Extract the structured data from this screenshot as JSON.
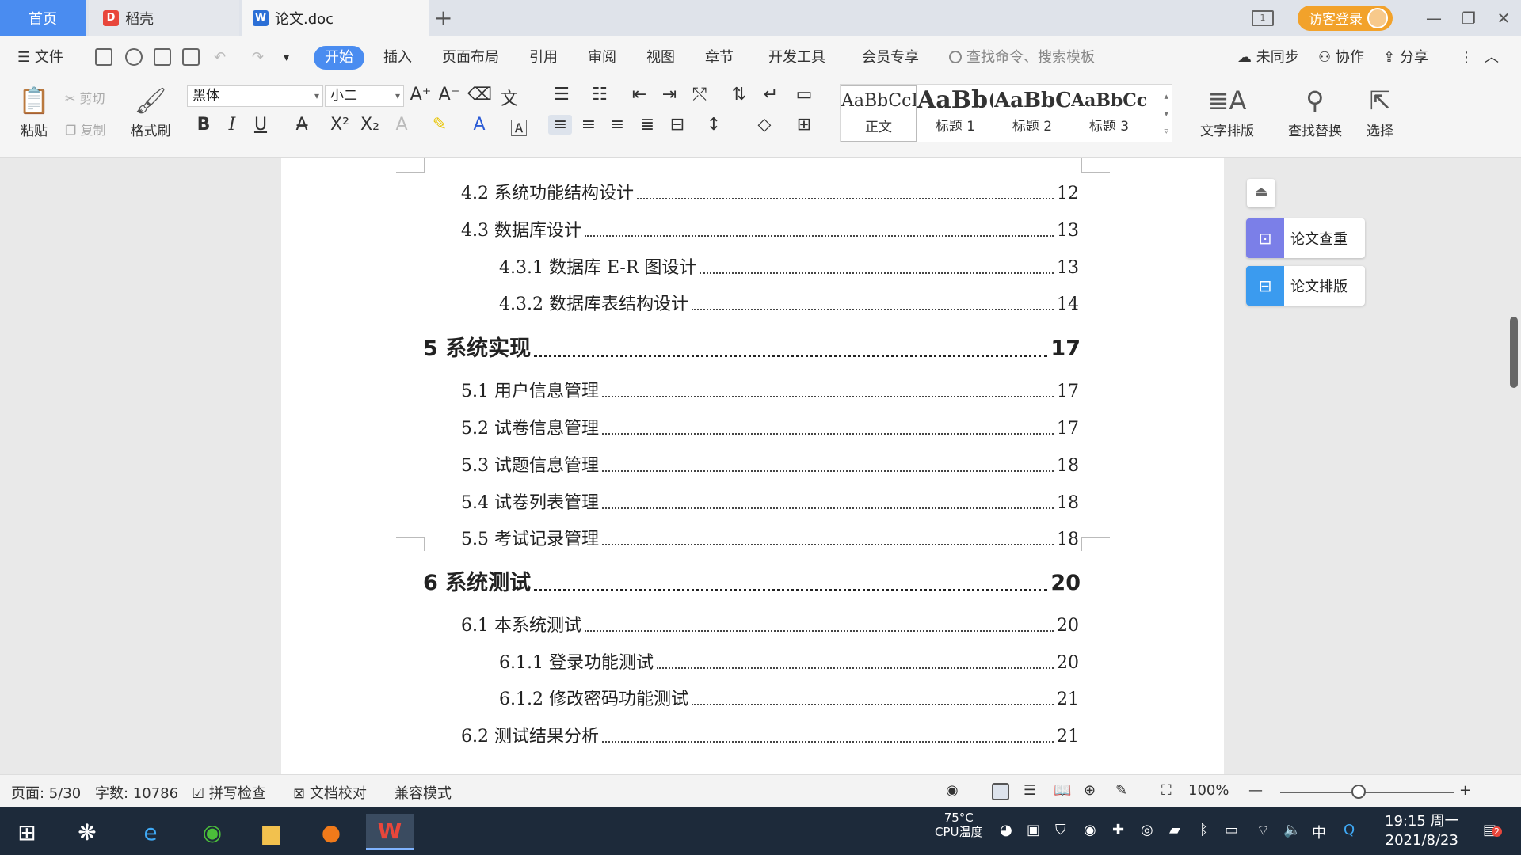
{
  "titlebar": {
    "tabs": [
      {
        "label": "首页"
      },
      {
        "label": "稻壳"
      },
      {
        "label": "论文.doc"
      }
    ],
    "add_tab": "+",
    "login_label": "访客登录"
  },
  "menubar": {
    "file": "文件",
    "tabs": [
      "开始",
      "插入",
      "页面布局",
      "引用",
      "审阅",
      "视图",
      "章节",
      "开发工具",
      "会员专享"
    ],
    "search_placeholder": "查找命令、搜索模板",
    "sync": "未同步",
    "collab": "协作",
    "share": "分享"
  },
  "ribbon": {
    "paste": "粘贴",
    "cut": "剪切",
    "copy": "复制",
    "format_painter": "格式刷",
    "font_name": "黑体",
    "font_size": "小二",
    "styles": [
      {
        "preview": "AaBbCcI",
        "label": "正文"
      },
      {
        "preview": "AaBb(",
        "label": "标题 1"
      },
      {
        "preview": "AaBbC",
        "label": "标题 2"
      },
      {
        "preview": "AaBbCcl",
        "label": "标题 3"
      }
    ],
    "text_layout": "文字排版",
    "find_replace": "查找替换",
    "select": "选择"
  },
  "toc": [
    {
      "title": "4.2 系统功能结构设计",
      "page": "12",
      "level": 2
    },
    {
      "title": "4.3 数据库设计",
      "page": "13",
      "level": 2
    },
    {
      "title": "4.3.1 数据库 E-R 图设计",
      "page": "13",
      "level": 3
    },
    {
      "title": "4.3.2  数据库表结构设计",
      "page": "14",
      "level": 3
    },
    {
      "title": "5  系统实现",
      "page": "17",
      "level": 1
    },
    {
      "title": "5.1 用户信息管理",
      "page": "17",
      "level": 2
    },
    {
      "title": "5.2  试卷信息管理",
      "page": "17",
      "level": 2
    },
    {
      "title": "5.3  试题信息管理",
      "page": "18",
      "level": 2
    },
    {
      "title": "5.4 试卷列表管理",
      "page": "18",
      "level": 2
    },
    {
      "title": "5.5 考试记录管理",
      "page": "18",
      "level": 2
    },
    {
      "title": "6 系统测试",
      "page": "20",
      "level": 1
    },
    {
      "title": "6.1  本系统测试",
      "page": "20",
      "level": 2
    },
    {
      "title": "6.1.1 登录功能测试",
      "page": "20",
      "level": 3
    },
    {
      "title": "6.1.2 修改密码功能测试",
      "page": "21",
      "level": 3
    },
    {
      "title": "6.2 测试结果分析",
      "page": "21",
      "level": 2
    }
  ],
  "float_panel": {
    "check": "论文查重",
    "layout": "论文排版"
  },
  "statusbar": {
    "page": "页面: 5/30",
    "words": "字数: 10786",
    "spell": "拼写检查",
    "proof": "文档校对",
    "compat": "兼容模式",
    "zoom": "100%",
    "zoom_level_percent": 100
  },
  "taskbar": {
    "cpu_temp": "75°C",
    "cpu_label": "CPU温度",
    "ime": "中",
    "time": "19:15 周一",
    "date": "2021/8/23",
    "notif_count": "2"
  },
  "colors": {
    "accent": "#4a8cf0",
    "login": "#f2a22b",
    "taskbar": "#1d2a3a"
  }
}
